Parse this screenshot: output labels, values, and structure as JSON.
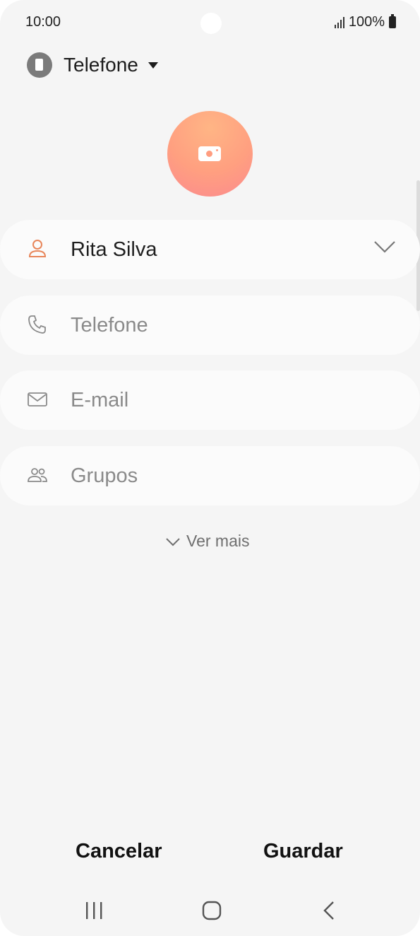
{
  "status_bar": {
    "time": "10:00",
    "battery": "100%"
  },
  "account": {
    "label": "Telefone",
    "icon": "phone-device-icon"
  },
  "photo": {
    "icon": "camera-icon",
    "gradient": [
      "#ffb585",
      "#fb8a8e"
    ]
  },
  "fields": {
    "name": {
      "value": "Rita Silva",
      "icon": "person-icon",
      "icon_color": "#e8865a"
    },
    "phone": {
      "placeholder": "Telefone",
      "icon": "phone-icon"
    },
    "email": {
      "placeholder": "E-mail",
      "icon": "email-icon"
    },
    "groups": {
      "placeholder": "Grupos",
      "icon": "groups-icon"
    }
  },
  "more": {
    "label": "Ver mais"
  },
  "actions": {
    "cancel": "Cancelar",
    "save": "Guardar"
  },
  "nav": {
    "recents": "recents-icon",
    "home": "home-icon",
    "back": "back-icon"
  }
}
